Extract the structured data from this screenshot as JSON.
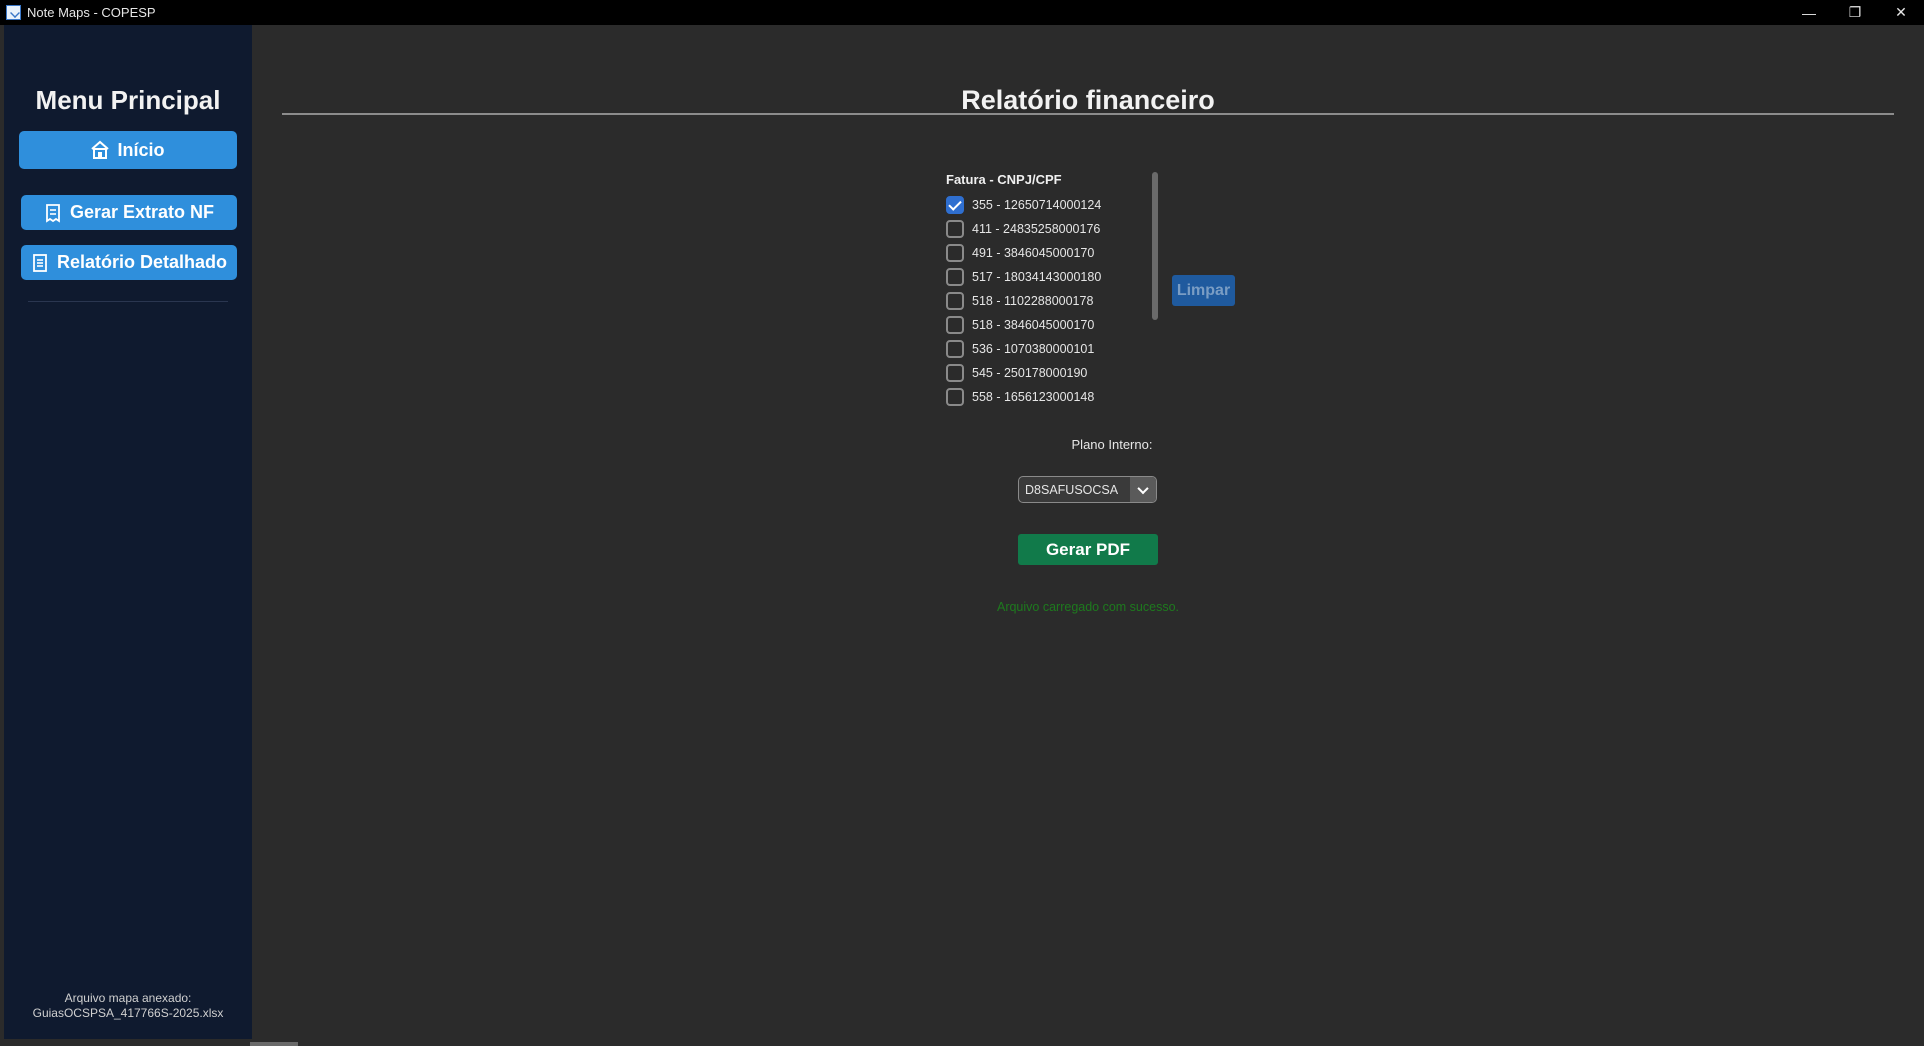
{
  "window": {
    "title": "Note Maps - COPESP",
    "minimize": "—",
    "restore": "❐",
    "close": "✕"
  },
  "sidebar": {
    "title": "Menu Principal",
    "buttons": [
      {
        "label": "Início",
        "icon": "home-icon"
      },
      {
        "label": "Gerar Extrato NF",
        "icon": "receipt-icon"
      },
      {
        "label": "Relatório Detalhado",
        "icon": "document-icon"
      }
    ],
    "footer_line1": "Arquivo mapa anexado:",
    "footer_line2": "GuiasOCSPSA_417766S-2025.xlsx"
  },
  "main": {
    "title": "Relatório financeiro",
    "list_header": "Fatura - CNPJ/CPF",
    "items": [
      {
        "label": "355 - 12650714000124",
        "checked": true
      },
      {
        "label": "411 - 24835258000176",
        "checked": false
      },
      {
        "label": "491 - 3846045000170",
        "checked": false
      },
      {
        "label": "517 - 18034143000180",
        "checked": false
      },
      {
        "label": "518 - 1102288000178",
        "checked": false
      },
      {
        "label": "518 - 3846045000170",
        "checked": false
      },
      {
        "label": "536 - 1070380000101",
        "checked": false
      },
      {
        "label": "545 - 250178000190",
        "checked": false
      },
      {
        "label": "558 - 1656123000148",
        "checked": false
      }
    ],
    "limpar_label": "Limpar",
    "plano_label": "Plano Interno:",
    "plano_value": "D8SAFUSOCSA",
    "pdf_label": "Gerar PDF",
    "status": "Arquivo carregado com sucesso."
  },
  "colors": {
    "sidebar_bg": "#0f1a2f",
    "primary_button": "#2f8fdc",
    "pdf_button": "#117a4a",
    "status_text": "#1e7a1e",
    "checkbox_checked": "#2f6fd0"
  }
}
